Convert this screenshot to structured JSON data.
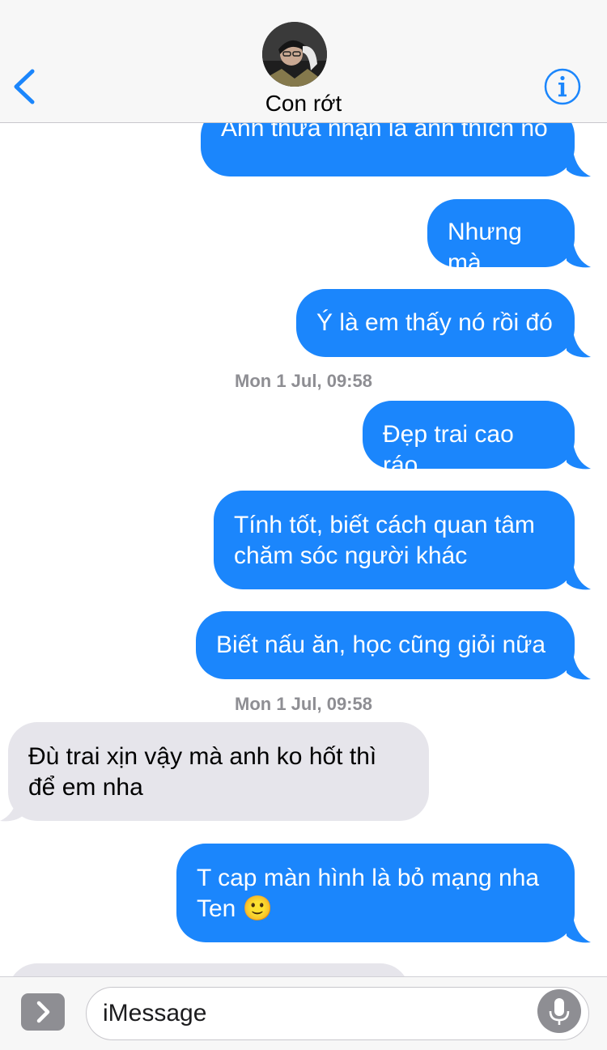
{
  "header": {
    "contact_name": "Con rớt",
    "back_icon": "chevron-left-icon",
    "info_icon": "info-icon",
    "accent_color": "#1b86fc"
  },
  "messages": [
    {
      "direction": "out",
      "text": "Anh thừa nhận là anh thích nó"
    },
    {
      "direction": "out",
      "text": "Nhưng mà"
    },
    {
      "direction": "out",
      "text": "Ý là em thấy nó rồi đó"
    },
    {
      "type": "timestamp",
      "day": "Mon 1 Jul,",
      "time": "09:58"
    },
    {
      "direction": "out",
      "text": "Đẹp trai cao ráo"
    },
    {
      "direction": "out",
      "text": "Tính tốt, biết cách quan tâm\nchăm sóc người khác"
    },
    {
      "direction": "out",
      "text": "Biết nấu ăn, học cũng giỏi nữa"
    },
    {
      "type": "timestamp",
      "day": "Mon 1 Jul,",
      "time": "09:58"
    },
    {
      "direction": "in",
      "text": "Đù trai xịn vậy mà anh ko hốt thì\nđể em nha"
    },
    {
      "direction": "out",
      "text": "T cap màn hình là bỏ mạng nha\nTen 🙂"
    }
  ],
  "composer": {
    "placeholder": "iMessage",
    "apps_icon": "chevron-right-icon",
    "mic_icon": "microphone-icon"
  },
  "colors": {
    "outgoing_bubble": "#1b86fc",
    "incoming_bubble": "#e6e5eb",
    "timestamp": "#8e8e93"
  }
}
